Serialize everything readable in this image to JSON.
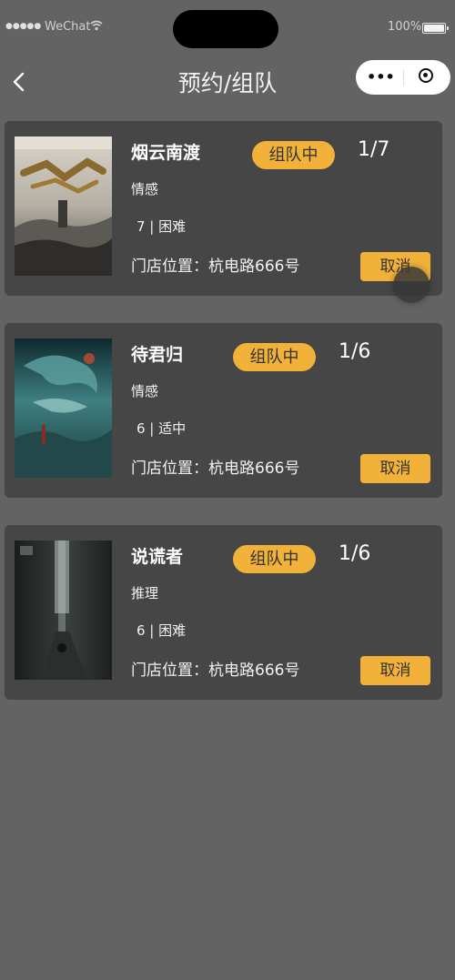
{
  "status_bar": {
    "signal": "●●●●●",
    "carrier": "WeChat",
    "battery_pct": "100%"
  },
  "nav": {
    "back_icon": "chevron-left-icon",
    "title": "预约/组队",
    "capsule_more": "•••"
  },
  "cards": [
    {
      "title": "烟云南渡",
      "status": "组队中",
      "count": "1/7",
      "genre": "情感",
      "meta": "7 | 困难",
      "location": "门店位置：杭电路666号",
      "cancel": "取消"
    },
    {
      "title": "待君归",
      "status": "组队中",
      "count": "1/6",
      "genre": "情感",
      "meta": "6 | 适中",
      "location": "门店位置：杭电路666号",
      "cancel": "取消"
    },
    {
      "title": "说谎者",
      "status": "组队中",
      "count": "1/6",
      "genre": "推理",
      "meta": "6 | 困难",
      "location": "门店位置：杭电路666号",
      "cancel": "取消"
    }
  ],
  "colors": {
    "background": "#646364",
    "card": "#474647",
    "accent": "#f2b23a"
  }
}
